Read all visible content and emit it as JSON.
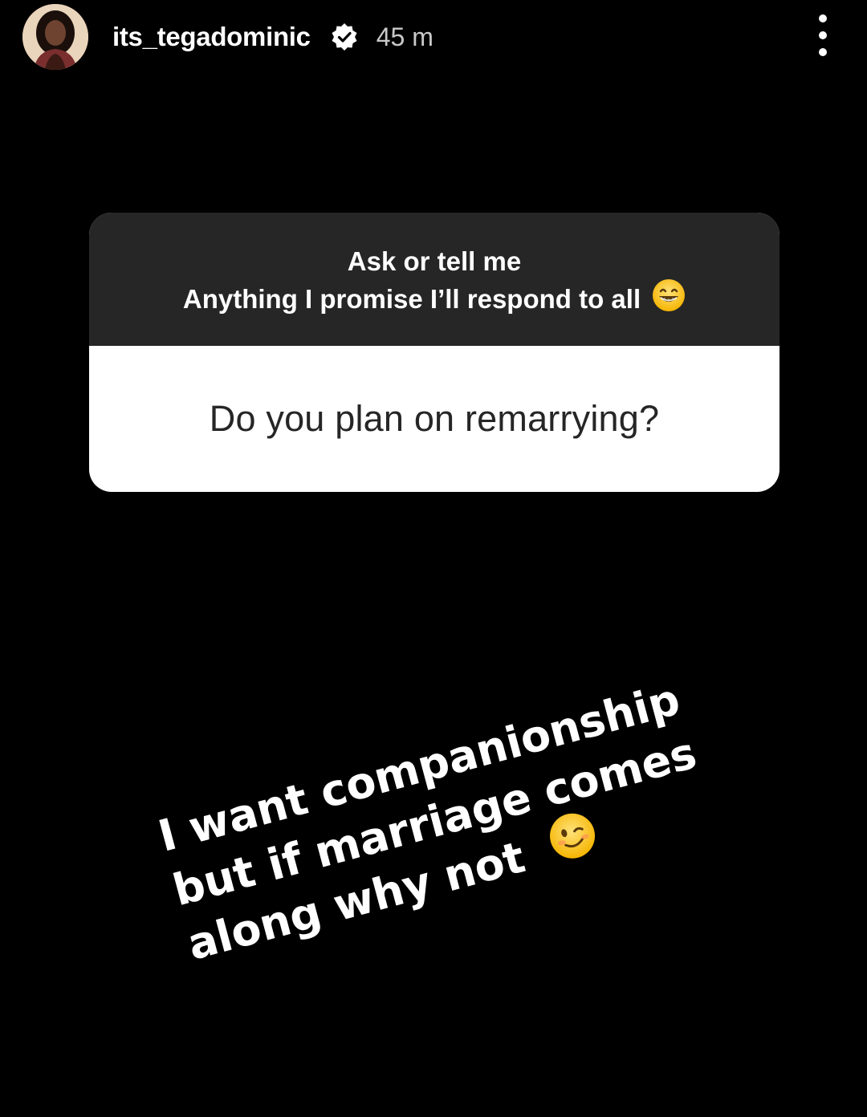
{
  "story": {
    "username": "its_tegadominic",
    "timestamp": "45 m",
    "verified": true
  },
  "question_sticker": {
    "prompt_line1": "Ask or tell me",
    "prompt_line2": "Anything I promise I’ll respond to all",
    "prompt_emoji": "grinning-face-with-smiling-eyes",
    "question": "Do you plan on remarrying?",
    "header_color": "#262626",
    "body_color": "#ffffff"
  },
  "reply": {
    "line1": "I want companionship",
    "line2": "but if marriage comes",
    "line3": "along why not",
    "emoji": "winking-face"
  },
  "colors": {
    "background": "#000000",
    "text": "#ffffff",
    "timestamp": "#c9c9c9"
  }
}
